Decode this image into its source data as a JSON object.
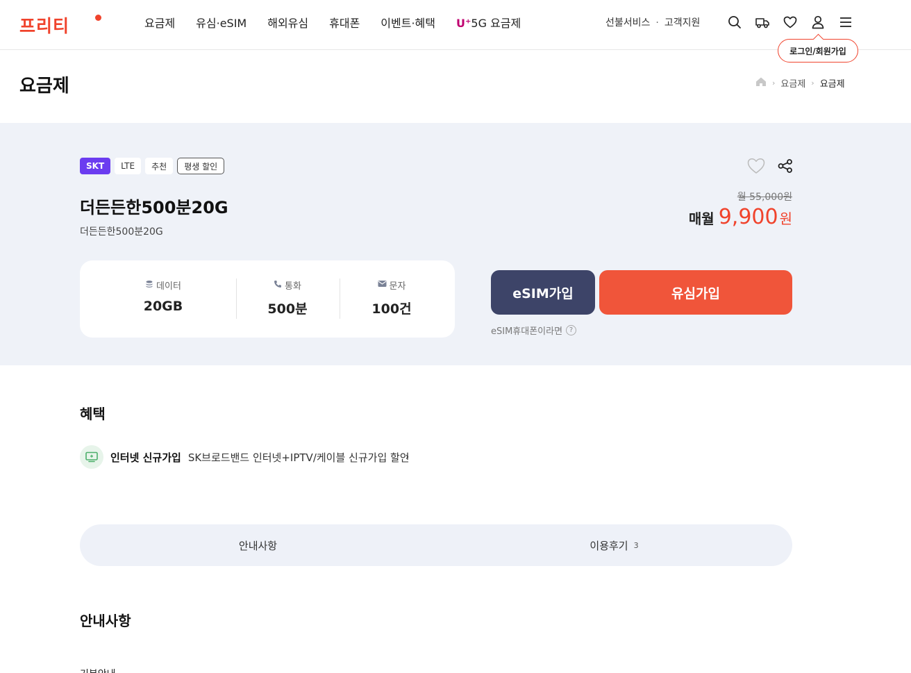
{
  "header": {
    "logo": "프리티",
    "nav": [
      "요금제",
      "유심·eSIM",
      "해외유심",
      "휴대폰",
      "이벤트·혜택"
    ],
    "nav_uplus_mark": "U⁺",
    "nav_uplus_label": "5G 요금제",
    "utility_prepaid": "선불서비스",
    "utility_support": "고객지원",
    "utility_sep": "·",
    "login_tooltip": "로그인/회원가입"
  },
  "page": {
    "title": "요금제",
    "breadcrumb": [
      "요금제",
      "요금제"
    ]
  },
  "product": {
    "badges": [
      "SKT",
      "LTE",
      "추천",
      "평생 할인"
    ],
    "name": "더든든한500분20G",
    "subtitle": "더든든한500분20G",
    "original_price": "월 55,000원",
    "price_label": "매월",
    "price_value": "9,900",
    "price_unit": "원",
    "specs": [
      {
        "label": "데이터",
        "value": "20GB",
        "icon": "data-icon"
      },
      {
        "label": "통화",
        "value": "500분",
        "icon": "phone-icon"
      },
      {
        "label": "문자",
        "value": "100건",
        "icon": "mail-icon"
      }
    ],
    "esim_button": "eSIM가입",
    "usim_button": "유심가입",
    "esim_note": "eSIM휴대폰이라면",
    "help_mark": "?"
  },
  "benefit": {
    "title": "혜택",
    "item_name": "인터넷 신규가입",
    "item_desc": "SK브로드밴드 인터넷+IPTV/케이블 신규가입 할인",
    "arrow": "›"
  },
  "tabs": [
    {
      "label": "안내사항",
      "count": ""
    },
    {
      "label": "이용후기",
      "count": "3"
    }
  ],
  "info": {
    "title": "안내사항",
    "subtitle": "기본안내"
  },
  "colors": {
    "brand": "#f0432c",
    "esim_button": "#3d4468",
    "usim_button": "#f0553a",
    "panel_bg": "#eff2f8",
    "skt_badge": "#6b3cf0"
  }
}
